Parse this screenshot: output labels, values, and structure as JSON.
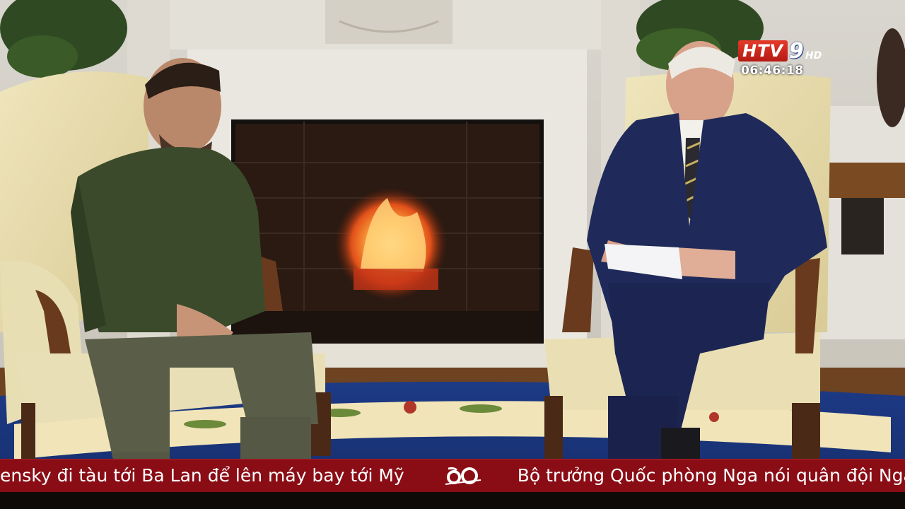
{
  "broadcast": {
    "channel_logo_text": "HTV",
    "channel_logo_number": "9",
    "channel_logo_hd": "HD",
    "clock": "06:46:18"
  },
  "ticker": {
    "headline_1": "ensky đi tàu tới Ba Lan để lên máy bay tới Mỹ",
    "separator_icon": "anniversary-60-logo",
    "headline_2": "Bộ trưởng Quốc phòng Nga nói quân đội Nga"
  },
  "colors": {
    "ticker_background": "#8a0d16",
    "logo_red": "#d42a1f"
  }
}
